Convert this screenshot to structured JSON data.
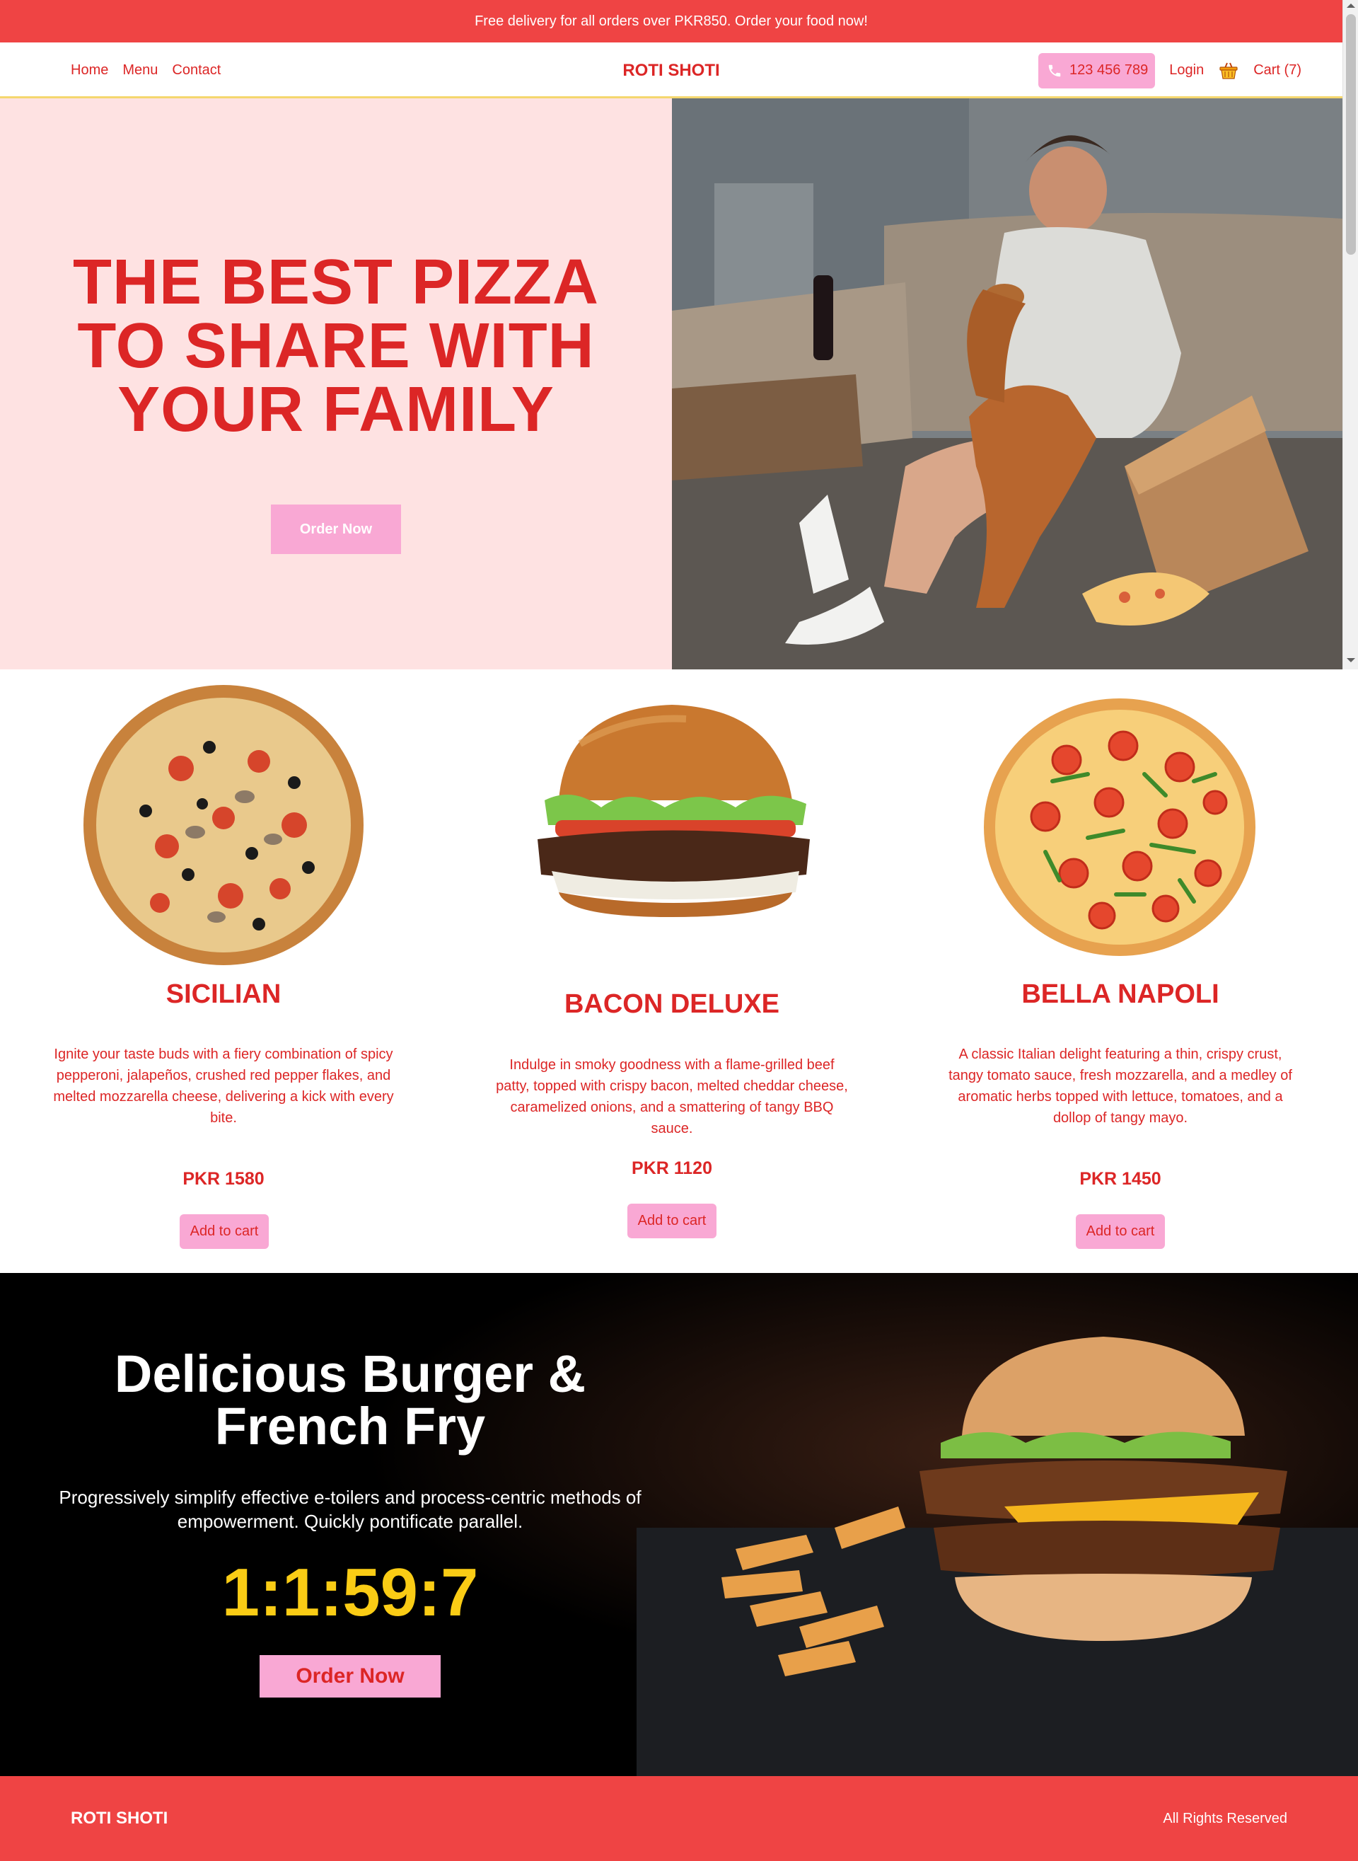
{
  "promo_bar": {
    "text": "Free delivery for all orders over PKR850. Order your food now!"
  },
  "header": {
    "nav": [
      {
        "label": "Home"
      },
      {
        "label": "Menu"
      },
      {
        "label": "Contact"
      }
    ],
    "brand": "ROTI SHOTI",
    "phone": "123 456 789",
    "login": "Login",
    "cart": "Cart (7)"
  },
  "hero": {
    "title": "THE BEST PIZZA TO SHARE WITH YOUR FAMILY",
    "button": "Order Now"
  },
  "products": [
    {
      "name": "SICILIAN",
      "description": "Ignite your taste buds with a fiery combination of spicy pepperoni, jalapeños, crushed red pepper flakes, and melted mozzarella cheese, delivering a kick with every bite.",
      "price": "PKR 1580",
      "button": "Add to cart"
    },
    {
      "name": "BACON DELUXE",
      "description": "Indulge in smoky goodness with a flame-grilled beef patty, topped with crispy bacon, melted cheddar cheese, caramelized onions, and a smattering of tangy BBQ sauce.",
      "price": "PKR 1120",
      "button": "Add to cart"
    },
    {
      "name": "BELLA NAPOLI",
      "description": "A classic Italian delight featuring a thin, crispy crust, tangy tomato sauce, fresh mozzarella, and a medley of aromatic herbs topped with lettuce, tomatoes, and a dollop of tangy mayo.",
      "price": "PKR 1450",
      "button": "Add to cart"
    }
  ],
  "deal": {
    "title": "Delicious Burger & French Fry",
    "text": "Progressively simplify effective e-toilers and process-centric methods of empowerment. Quickly pontificate parallel.",
    "countdown": "1:1:59:7",
    "button": "Order Now"
  },
  "footer": {
    "brand": "ROTI SHOTI",
    "rights": "All Rights Reserved"
  },
  "colors": {
    "accent_red": "#dc2626",
    "bar_red": "#ef4444",
    "pink": "#f9a8d4",
    "hero_bg": "#fee2e2",
    "countdown_yellow": "#facc15"
  }
}
